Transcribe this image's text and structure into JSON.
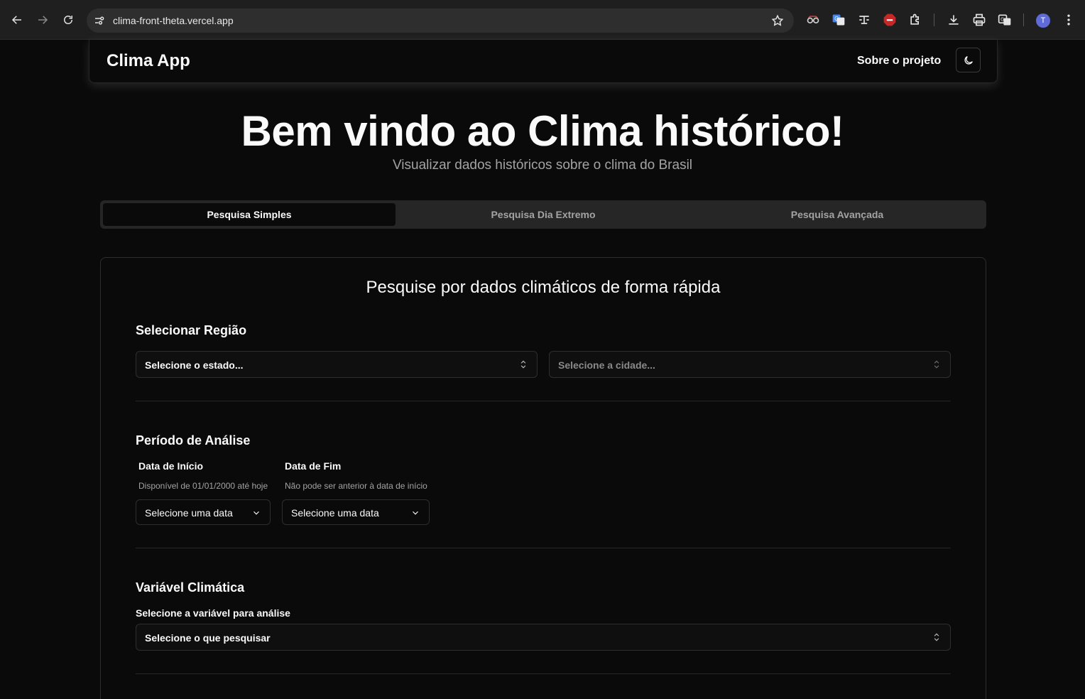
{
  "browser": {
    "url": "clima-front-theta.vercel.app",
    "profile_initial": "T",
    "icons": [
      "back-icon",
      "forward-icon",
      "reload-icon",
      "site-info-icon",
      "bookmark-star-icon",
      "extension-glasses-icon",
      "google-translate-icon",
      "text-tool-icon",
      "adblock-icon",
      "extensions-puzzle-icon",
      "download-icon",
      "print-icon",
      "translate-page-icon",
      "more-menu-icon"
    ]
  },
  "header": {
    "brand": "Clima App",
    "about_link": "Sobre o projeto",
    "theme_toggle_icon": "moon-icon"
  },
  "hero": {
    "title": "Bem vindo ao Clima histórico!",
    "subtitle": "Visualizar dados históricos sobre o clima do Brasil"
  },
  "tabs": [
    {
      "label": "Pesquisa Simples",
      "active": true
    },
    {
      "label": "Pesquisa Dia Extremo",
      "active": false
    },
    {
      "label": "Pesquisa Avançada",
      "active": false
    }
  ],
  "card": {
    "title": "Pesquise por dados climáticos de forma rápida",
    "region": {
      "title": "Selecionar Região",
      "state_placeholder": "Selecione o estado...",
      "city_placeholder": "Selecione a cidade..."
    },
    "period": {
      "title": "Período de Análise",
      "start_label": "Data de Início",
      "start_hint": "Disponível de 01/01/2000 até hoje",
      "start_value": "Selecione uma data",
      "end_label": "Data de Fim",
      "end_hint": "Não pode ser anterior à data de início",
      "end_value": "Selecione uma data"
    },
    "variable": {
      "title": "Variável Climática",
      "label": "Selecione a variável para análise",
      "placeholder": "Selecione o que pesquisar"
    }
  },
  "colors": {
    "background": "#0a0a0a",
    "chrome": "#1f1f1f",
    "tabs_bg": "#262626",
    "muted_text": "#a3a3a3",
    "border": "#2e2e2e"
  }
}
